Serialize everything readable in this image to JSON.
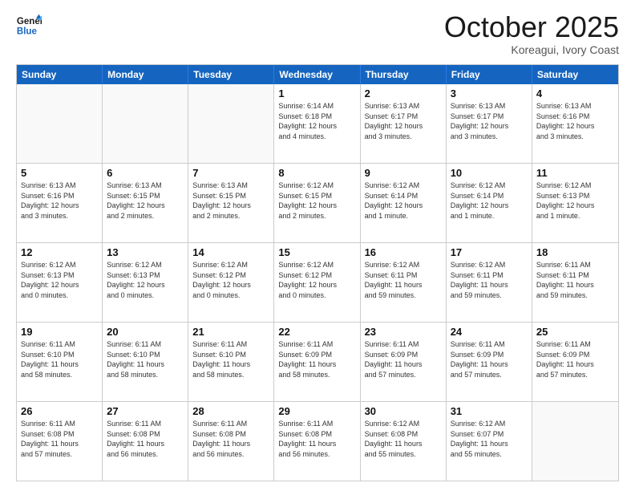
{
  "header": {
    "logo_line1": "General",
    "logo_line2": "Blue",
    "month_title": "October 2025",
    "subtitle": "Koreagui, Ivory Coast"
  },
  "weekdays": [
    "Sunday",
    "Monday",
    "Tuesday",
    "Wednesday",
    "Thursday",
    "Friday",
    "Saturday"
  ],
  "rows": [
    [
      {
        "day": "",
        "text": ""
      },
      {
        "day": "",
        "text": ""
      },
      {
        "day": "",
        "text": ""
      },
      {
        "day": "1",
        "text": "Sunrise: 6:14 AM\nSunset: 6:18 PM\nDaylight: 12 hours\nand 4 minutes."
      },
      {
        "day": "2",
        "text": "Sunrise: 6:13 AM\nSunset: 6:17 PM\nDaylight: 12 hours\nand 3 minutes."
      },
      {
        "day": "3",
        "text": "Sunrise: 6:13 AM\nSunset: 6:17 PM\nDaylight: 12 hours\nand 3 minutes."
      },
      {
        "day": "4",
        "text": "Sunrise: 6:13 AM\nSunset: 6:16 PM\nDaylight: 12 hours\nand 3 minutes."
      }
    ],
    [
      {
        "day": "5",
        "text": "Sunrise: 6:13 AM\nSunset: 6:16 PM\nDaylight: 12 hours\nand 3 minutes."
      },
      {
        "day": "6",
        "text": "Sunrise: 6:13 AM\nSunset: 6:15 PM\nDaylight: 12 hours\nand 2 minutes."
      },
      {
        "day": "7",
        "text": "Sunrise: 6:13 AM\nSunset: 6:15 PM\nDaylight: 12 hours\nand 2 minutes."
      },
      {
        "day": "8",
        "text": "Sunrise: 6:12 AM\nSunset: 6:15 PM\nDaylight: 12 hours\nand 2 minutes."
      },
      {
        "day": "9",
        "text": "Sunrise: 6:12 AM\nSunset: 6:14 PM\nDaylight: 12 hours\nand 1 minute."
      },
      {
        "day": "10",
        "text": "Sunrise: 6:12 AM\nSunset: 6:14 PM\nDaylight: 12 hours\nand 1 minute."
      },
      {
        "day": "11",
        "text": "Sunrise: 6:12 AM\nSunset: 6:13 PM\nDaylight: 12 hours\nand 1 minute."
      }
    ],
    [
      {
        "day": "12",
        "text": "Sunrise: 6:12 AM\nSunset: 6:13 PM\nDaylight: 12 hours\nand 0 minutes."
      },
      {
        "day": "13",
        "text": "Sunrise: 6:12 AM\nSunset: 6:13 PM\nDaylight: 12 hours\nand 0 minutes."
      },
      {
        "day": "14",
        "text": "Sunrise: 6:12 AM\nSunset: 6:12 PM\nDaylight: 12 hours\nand 0 minutes."
      },
      {
        "day": "15",
        "text": "Sunrise: 6:12 AM\nSunset: 6:12 PM\nDaylight: 12 hours\nand 0 minutes."
      },
      {
        "day": "16",
        "text": "Sunrise: 6:12 AM\nSunset: 6:11 PM\nDaylight: 11 hours\nand 59 minutes."
      },
      {
        "day": "17",
        "text": "Sunrise: 6:12 AM\nSunset: 6:11 PM\nDaylight: 11 hours\nand 59 minutes."
      },
      {
        "day": "18",
        "text": "Sunrise: 6:11 AM\nSunset: 6:11 PM\nDaylight: 11 hours\nand 59 minutes."
      }
    ],
    [
      {
        "day": "19",
        "text": "Sunrise: 6:11 AM\nSunset: 6:10 PM\nDaylight: 11 hours\nand 58 minutes."
      },
      {
        "day": "20",
        "text": "Sunrise: 6:11 AM\nSunset: 6:10 PM\nDaylight: 11 hours\nand 58 minutes."
      },
      {
        "day": "21",
        "text": "Sunrise: 6:11 AM\nSunset: 6:10 PM\nDaylight: 11 hours\nand 58 minutes."
      },
      {
        "day": "22",
        "text": "Sunrise: 6:11 AM\nSunset: 6:09 PM\nDaylight: 11 hours\nand 58 minutes."
      },
      {
        "day": "23",
        "text": "Sunrise: 6:11 AM\nSunset: 6:09 PM\nDaylight: 11 hours\nand 57 minutes."
      },
      {
        "day": "24",
        "text": "Sunrise: 6:11 AM\nSunset: 6:09 PM\nDaylight: 11 hours\nand 57 minutes."
      },
      {
        "day": "25",
        "text": "Sunrise: 6:11 AM\nSunset: 6:09 PM\nDaylight: 11 hours\nand 57 minutes."
      }
    ],
    [
      {
        "day": "26",
        "text": "Sunrise: 6:11 AM\nSunset: 6:08 PM\nDaylight: 11 hours\nand 57 minutes."
      },
      {
        "day": "27",
        "text": "Sunrise: 6:11 AM\nSunset: 6:08 PM\nDaylight: 11 hours\nand 56 minutes."
      },
      {
        "day": "28",
        "text": "Sunrise: 6:11 AM\nSunset: 6:08 PM\nDaylight: 11 hours\nand 56 minutes."
      },
      {
        "day": "29",
        "text": "Sunrise: 6:11 AM\nSunset: 6:08 PM\nDaylight: 11 hours\nand 56 minutes."
      },
      {
        "day": "30",
        "text": "Sunrise: 6:12 AM\nSunset: 6:08 PM\nDaylight: 11 hours\nand 55 minutes."
      },
      {
        "day": "31",
        "text": "Sunrise: 6:12 AM\nSunset: 6:07 PM\nDaylight: 11 hours\nand 55 minutes."
      },
      {
        "day": "",
        "text": ""
      }
    ]
  ]
}
